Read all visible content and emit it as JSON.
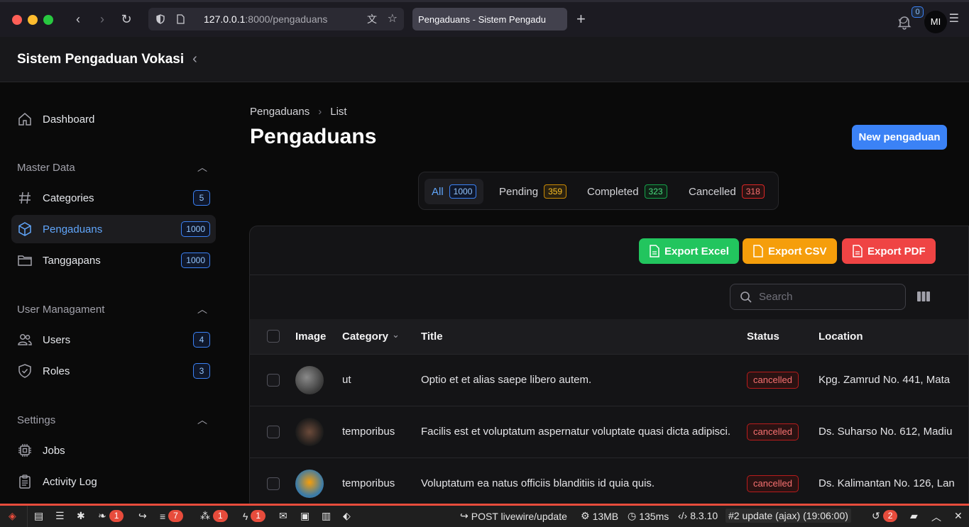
{
  "browser": {
    "url_host": "127.0.0.1",
    "url_rest": ":8000/pengaduans",
    "tab_title": "Pengaduans - Sistem Pengadu"
  },
  "app": {
    "brand": "Sistem Pengaduan Vokasi",
    "notification_count": "0",
    "avatar_initials": "MI"
  },
  "sidebar": {
    "dashboard": "Dashboard",
    "groups": [
      {
        "label": "Master Data"
      },
      {
        "label": "User Managament"
      },
      {
        "label": "Settings"
      }
    ],
    "items": [
      {
        "label": "Categories",
        "badge": "5"
      },
      {
        "label": "Pengaduans",
        "badge": "1000"
      },
      {
        "label": "Tanggapans",
        "badge": "1000"
      },
      {
        "label": "Users",
        "badge": "4"
      },
      {
        "label": "Roles",
        "badge": "3"
      },
      {
        "label": "Jobs"
      },
      {
        "label": "Activity Log"
      }
    ]
  },
  "main": {
    "breadcrumb": [
      "Pengaduans",
      "List"
    ],
    "title": "Pengaduans",
    "new_button": "New pengaduan",
    "tabs": [
      {
        "label": "All",
        "count": "1000"
      },
      {
        "label": "Pending",
        "count": "359"
      },
      {
        "label": "Completed",
        "count": "323"
      },
      {
        "label": "Cancelled",
        "count": "318"
      }
    ],
    "exports": {
      "excel": "Export Excel",
      "csv": "Export CSV",
      "pdf": "Export PDF"
    },
    "search_placeholder": "Search",
    "columns": {
      "image": "Image",
      "category": "Category",
      "title": "Title",
      "status": "Status",
      "location": "Location"
    },
    "rows": [
      {
        "category": "ut",
        "title": "Optio et et alias saepe libero autem.",
        "status": "cancelled",
        "location": "Kpg. Zamrud No. 441, Mata"
      },
      {
        "category": "temporibus",
        "title": "Facilis est et voluptatum aspernatur voluptate quasi dicta adipisci.",
        "status": "cancelled",
        "location": "Ds. Suharso No. 612, Madiu"
      },
      {
        "category": "temporibus",
        "title": "Voluptatum ea natus officiis blanditiis id quia quis.",
        "status": "cancelled",
        "location": "Ds. Kalimantan No. 126, Lan"
      }
    ]
  },
  "debugbar": {
    "badges": [
      "1",
      "7",
      "1",
      "1"
    ],
    "request": "POST livewire/update",
    "memory": "13MB",
    "time": "135ms",
    "php": "8.3.10",
    "update": "#2 update (ajax) (19:06:00)",
    "history_count": "2"
  },
  "colors": {
    "primary": "#3b82f6",
    "excel": "#22c55e",
    "csv": "#f59e0b",
    "pdf": "#ef4444",
    "debug_accent": "#e74c3c"
  }
}
